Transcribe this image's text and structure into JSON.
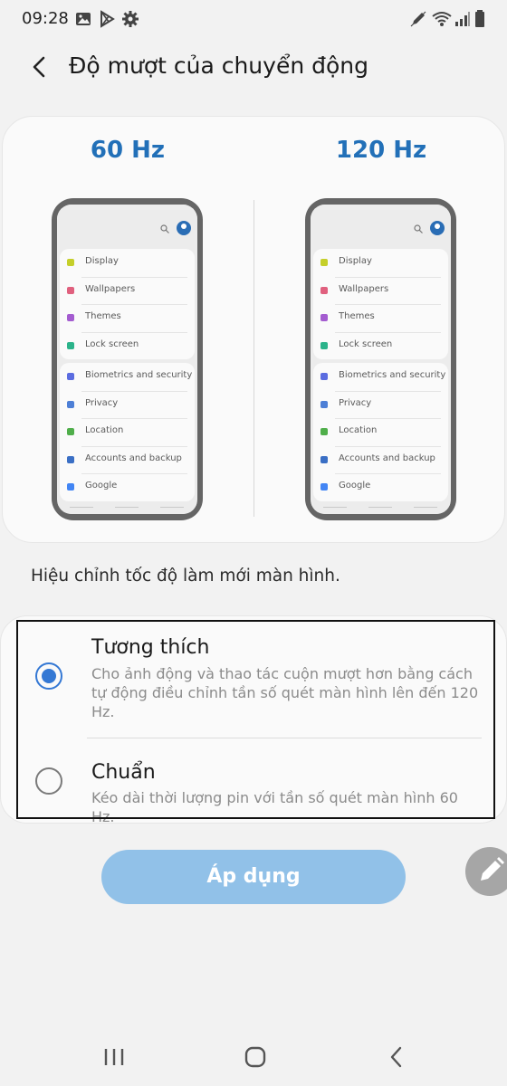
{
  "status_bar": {
    "time": "09:28",
    "left_icons": [
      "gallery-icon",
      "play-store-icon",
      "settings-gear-icon"
    ],
    "right_icons": [
      "edit-pen-icon",
      "wifi-icon",
      "signal-icon",
      "battery-icon"
    ]
  },
  "header": {
    "title": "Độ mượt của chuyển động",
    "back_icon": "back-arrow-icon"
  },
  "preview": {
    "left_label": "60 Hz",
    "right_label": "120 Hz",
    "menu_group_1": [
      {
        "label": "Display",
        "icon": "sun-icon",
        "color": "#c5cf2a"
      },
      {
        "label": "Wallpapers",
        "icon": "wallpaper-icon",
        "color": "#e0607e"
      },
      {
        "label": "Themes",
        "icon": "themes-icon",
        "color": "#a45cd0"
      },
      {
        "label": "Lock screen",
        "icon": "lock-screen-icon",
        "color": "#2bb38a"
      }
    ],
    "menu_group_2": [
      {
        "label": "Biometrics and security",
        "icon": "shield-icon",
        "color": "#5b6ce0"
      },
      {
        "label": "Privacy",
        "icon": "privacy-icon",
        "color": "#4d7fd6"
      },
      {
        "label": "Location",
        "icon": "location-pin-icon",
        "color": "#4fae4a"
      },
      {
        "label": "Accounts and backup",
        "icon": "key-icon",
        "color": "#3a6fc5"
      },
      {
        "label": "Google",
        "icon": "google-icon",
        "color": "#4285f4"
      }
    ]
  },
  "description": "Hiệu chỉnh tốc độ làm mới màn hình.",
  "options": [
    {
      "title": "Tương thích",
      "description": "Cho ảnh động và thao tác cuộn mượt hơn bằng cách tự động điều chỉnh tần số quét màn hình lên đến 120 Hz.",
      "selected": true
    },
    {
      "title": "Chuẩn",
      "description": "Kéo dài thời lượng pin với tần số quét màn hình 60 Hz.",
      "selected": false
    }
  ],
  "apply_button": "Áp dụng",
  "nav_bar": [
    "recents-icon",
    "home-icon",
    "back-nav-icon"
  ],
  "colors": {
    "accent": "#3478d4",
    "hz_label": "#2270b8",
    "apply_button_bg": "#91c1e8"
  }
}
